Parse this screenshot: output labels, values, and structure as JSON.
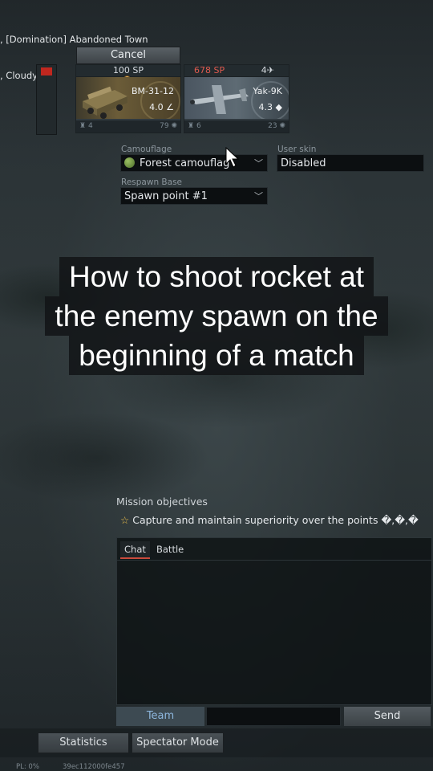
{
  "header": {
    "line1": ", [Domination] Abandoned Town",
    "line2": ", Cloudy"
  },
  "cancel_label": "Cancel",
  "units": [
    {
      "cost": "100 SP",
      "name": "BM-31-12",
      "br": "4.0 ∠",
      "crew": "4",
      "stat": "79"
    },
    {
      "cost": "678 SP",
      "count": "4",
      "name": "Yak-9K",
      "br": "4.3 ◆",
      "crew": "6",
      "stat": "23"
    }
  ],
  "camouflage": {
    "label": "Camouflage",
    "value": "Forest camouflag"
  },
  "user_skin": {
    "label": "User skin",
    "value": "Disabled"
  },
  "respawn": {
    "label": "Respawn Base",
    "value": "Spawn point #1"
  },
  "caption": {
    "line1": "How to shoot rocket at",
    "line2": "the enemy spawn on the",
    "line3": "beginning of a match"
  },
  "mission": {
    "title": "Mission objectives",
    "text": "Capture and maintain superiority over the points �,�,�"
  },
  "chat": {
    "tabs": [
      "Chat",
      "Battle"
    ],
    "team_label": "Team",
    "send_label": "Send"
  },
  "bottom_buttons": [
    "Statistics",
    "Spectator Mode"
  ],
  "status": {
    "pl": "PL: 0%",
    "id": "39ec112000fe457"
  }
}
